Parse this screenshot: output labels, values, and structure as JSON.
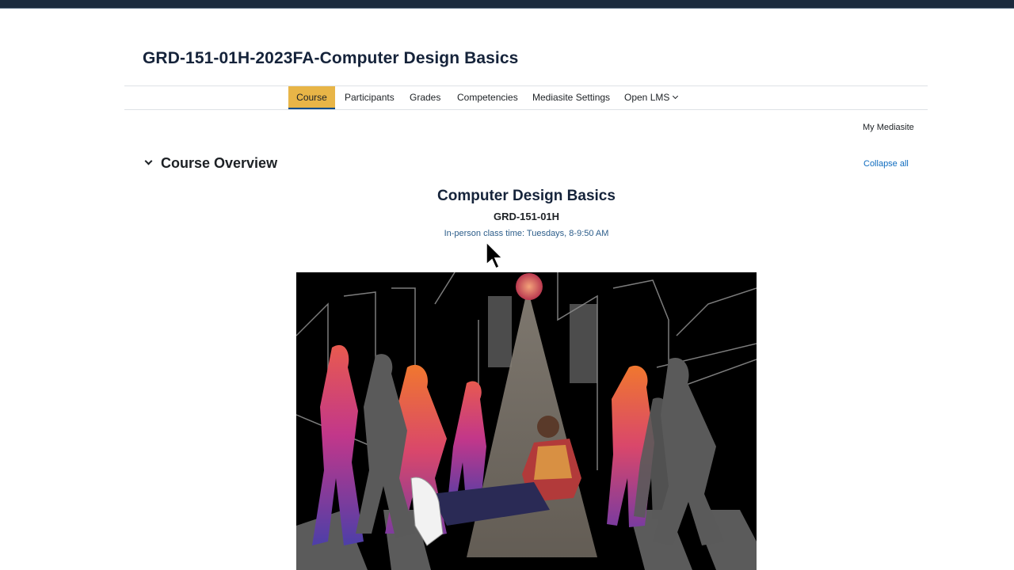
{
  "header": {
    "course_title": "GRD-151-01H-2023FA-Computer Design Basics"
  },
  "nav": {
    "tabs": [
      {
        "label": "Course",
        "active": true
      },
      {
        "label": "Participants",
        "active": false
      },
      {
        "label": "Grades",
        "active": false
      },
      {
        "label": "Competencies",
        "active": false
      },
      {
        "label": "Mediasite Settings",
        "active": false
      },
      {
        "label": "Open LMS",
        "active": false
      }
    ]
  },
  "blocks": {
    "my_mediasite": "My Mediasite"
  },
  "section": {
    "title": "Course Overview",
    "collapse_all": "Collapse all"
  },
  "overview": {
    "title": "Computer Design Basics",
    "code": "GRD-151-01H",
    "class_time": "In-person class time: Tuesdays, 8-9:50 AM"
  },
  "colors": {
    "accent_active_tab": "#e8b547",
    "top_bar": "#1b2a3d",
    "link": "#0f6cbf"
  }
}
